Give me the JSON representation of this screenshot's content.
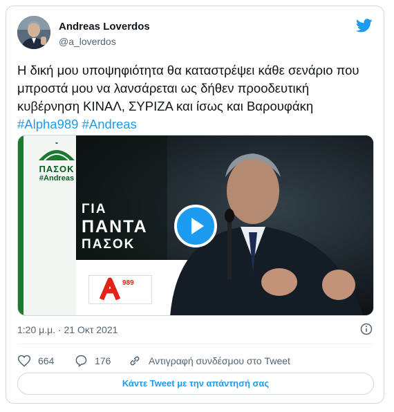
{
  "tweet": {
    "author_name": "Andreas Loverdos",
    "author_handle": "@a_loverdos",
    "text_main": "Η δική μου υποψηφιότητα θα καταστρέψει κάθε σενάριο που μπροστά μου να λανσάρεται ως δήθεν προοδευτική κυβέρνηση ΚΙΝΑΛ, ΣΥΡΙΖΑ και ίσως και Βαρουφάκη ",
    "hashtag_1": "#Alpha989",
    "hashtag_2": "#Andreas",
    "timestamp": "1:20 μ.μ. · 21 Οκτ 2021",
    "likes": "664",
    "replies": "176",
    "copy_link": "Αντιγραφή συνδέσμου στο Tweet",
    "reply_button": "Κάντε Tweet με την απάντησή σας"
  },
  "media": {
    "party_logo_text": "ΠΑΣΟΚ",
    "party_hashtag": "#Andreas",
    "slogan_line1": "ΓΙΑ",
    "slogan_line2": "ΠΑΝΤΑ",
    "slogan_line3": "ΠΑΣΟΚ",
    "station_logo_text": "989"
  },
  "colors": {
    "accent": "#1d9bf0",
    "pasok_green": "#1a7a2e",
    "border": "#cfd9de",
    "muted": "#536471"
  }
}
